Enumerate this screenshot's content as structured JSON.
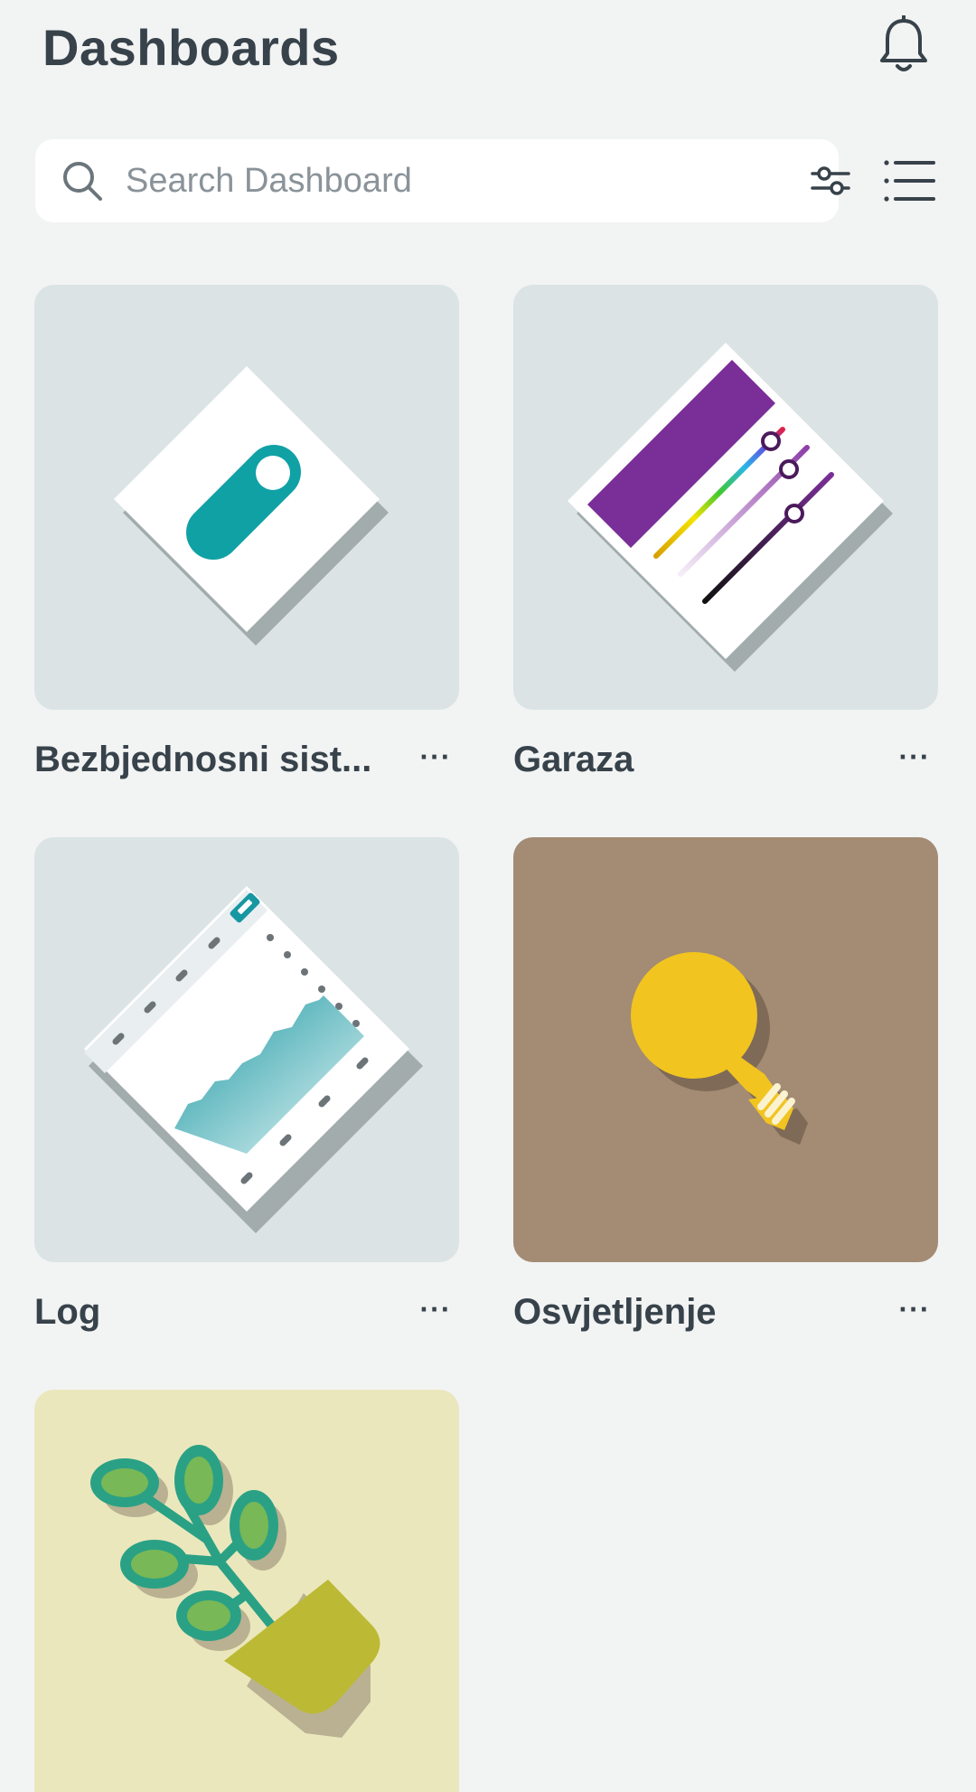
{
  "header": {
    "title": "Dashboards"
  },
  "search": {
    "placeholder": "Search Dashboard",
    "value": ""
  },
  "dashboards": [
    {
      "label": "Bezbjednosni sist...",
      "more": "···",
      "thumbnail": "toggle-switch",
      "color": "#dbe3e5"
    },
    {
      "label": "Garaza",
      "more": "···",
      "thumbnail": "color-sliders",
      "color": "#dbe3e5"
    },
    {
      "label": "Log",
      "more": "···",
      "thumbnail": "area-chart",
      "color": "#dbe3e5"
    },
    {
      "label": "Osvjetljenje",
      "more": "···",
      "thumbnail": "light-bulb",
      "color": "#a38b74"
    },
    {
      "label": "",
      "more": "",
      "thumbnail": "potted-plant",
      "color": "#ebe7bd"
    }
  ],
  "colors": {
    "background": "#f2f3f3",
    "text": "#37424a",
    "accent_teal": "#14a3a6",
    "accent_purple": "#7a2e98",
    "bulb_yellow": "#f1c420"
  }
}
